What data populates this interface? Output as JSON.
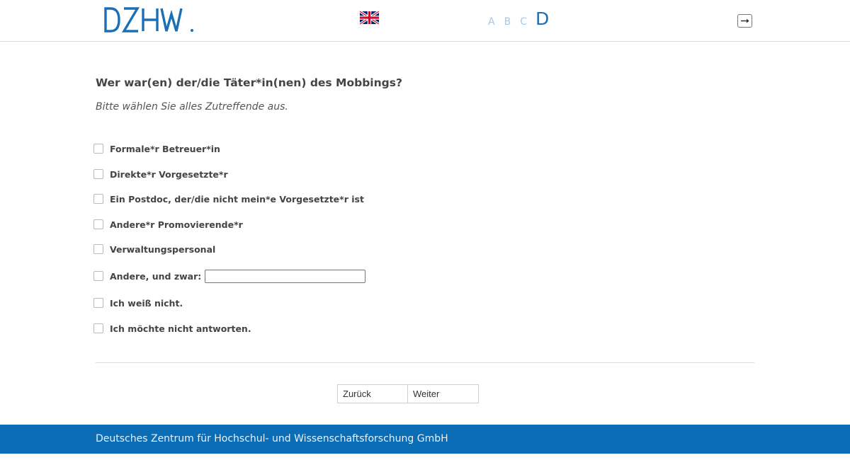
{
  "header": {
    "logo_text": "DZHW.",
    "language_icon": "uk-flag-icon",
    "font_sizes": [
      "A",
      "B",
      "C",
      "D"
    ],
    "exit_icon": "exit-icon"
  },
  "main": {
    "question": "Wer war(en) der/die Täter*in(nen) des Mobbings?",
    "instruction": "Bitte wählen Sie alles Zutreffende aus.",
    "options": [
      "Formale*r Betreuer*in",
      "Direkte*r Vorgesetzte*r",
      "Ein Postdoc, der/die nicht mein*e Vorgesetzte*r ist",
      "Andere*r Promovierende*r",
      "Verwaltungspersonal",
      "Andere, und zwar:",
      "Ich weiß nicht.",
      "Ich möchte nicht antworten."
    ],
    "other_input_value": ""
  },
  "navigation": {
    "back_label": "Zurück",
    "next_label": "Weiter"
  },
  "footer": {
    "text": "Deutsches Zentrum für Hochschul- und Wissenschaftsforschung GmbH"
  },
  "colors": {
    "brand_blue": "#0a6db5",
    "logo_blue": "#1c6fb5",
    "font_size_inactive": "#a8c8e4"
  }
}
